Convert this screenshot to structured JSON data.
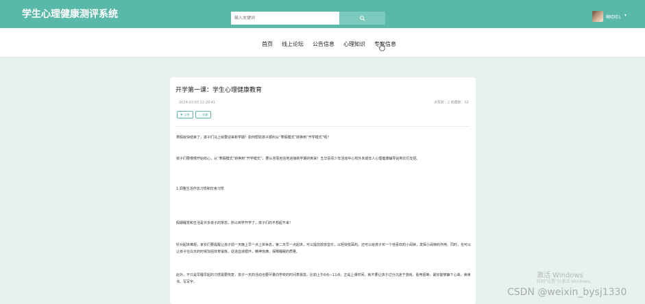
{
  "header": {
    "title": "学生心理健康测评系统",
    "search_placeholder": "输入关键词",
    "search_button_icon": "search-icon",
    "user_name": "啊哈哈1",
    "dropdown_symbol": "▾"
  },
  "nav": {
    "items": [
      "首页",
      "线上论坛",
      "公告信息",
      "心理知识",
      "专家信息"
    ]
  },
  "article": {
    "title": "开学第一课：学生心理健康教育",
    "date": "2024-03-03 12:29:41",
    "stats": "点赞数：2   收藏数：62",
    "like_label": "点赞",
    "collect_label": "收藏",
    "paragraphs": [
      "寒假就快结束了，孩子们马上就要迎来新学期！如何帮助孩子顺利从“寒假模式”转换到“开学模式”呢？",
      "孩子们要慢慢开始收心，从“寒假模式”转换到“开学模式”，要从容而自信地迎接新学期的到来！五华县青少年活动中心校外未成年人心理健康辅导站寄长们支招。",
      "1.调整生活作息习惯和饮食习惯",
      "假期睡觉和生活是许多孩子的常态，所以到学开学了，孩子们的不想起不来！",
      "针对起床难题，家长们要提醒让孩子前一天晚上早一点上床休息，第二天早一点起床，可以提前放放音乐，以轻快悦耳的。还可以给孩子买一个他喜欢的小闹钟，发挥小闹钟的作用。同时，也可以让孩子在白天的时候加强体育锻炼，促进血液循环，精神饱满，保障睡眠的质量。",
      "此外，不只是早睡早起的习惯需要恢复，孩子一天的活动也要尽量向学校的时间表靠拢。比如上午8点—11点，正是上课时间，就不要让孩子过分沉迷于游戏、看电视等，最好能够静下心来，读读书、写写字。"
    ]
  },
  "watermark": {
    "line1": "激活 Windows",
    "line2": "转到“设置”以激活 Windows。",
    "line3": "CSDN @weixin_bysj1330"
  },
  "colors": {
    "brand": "#5ab8a8",
    "page_bg": "#e6f2ef"
  }
}
